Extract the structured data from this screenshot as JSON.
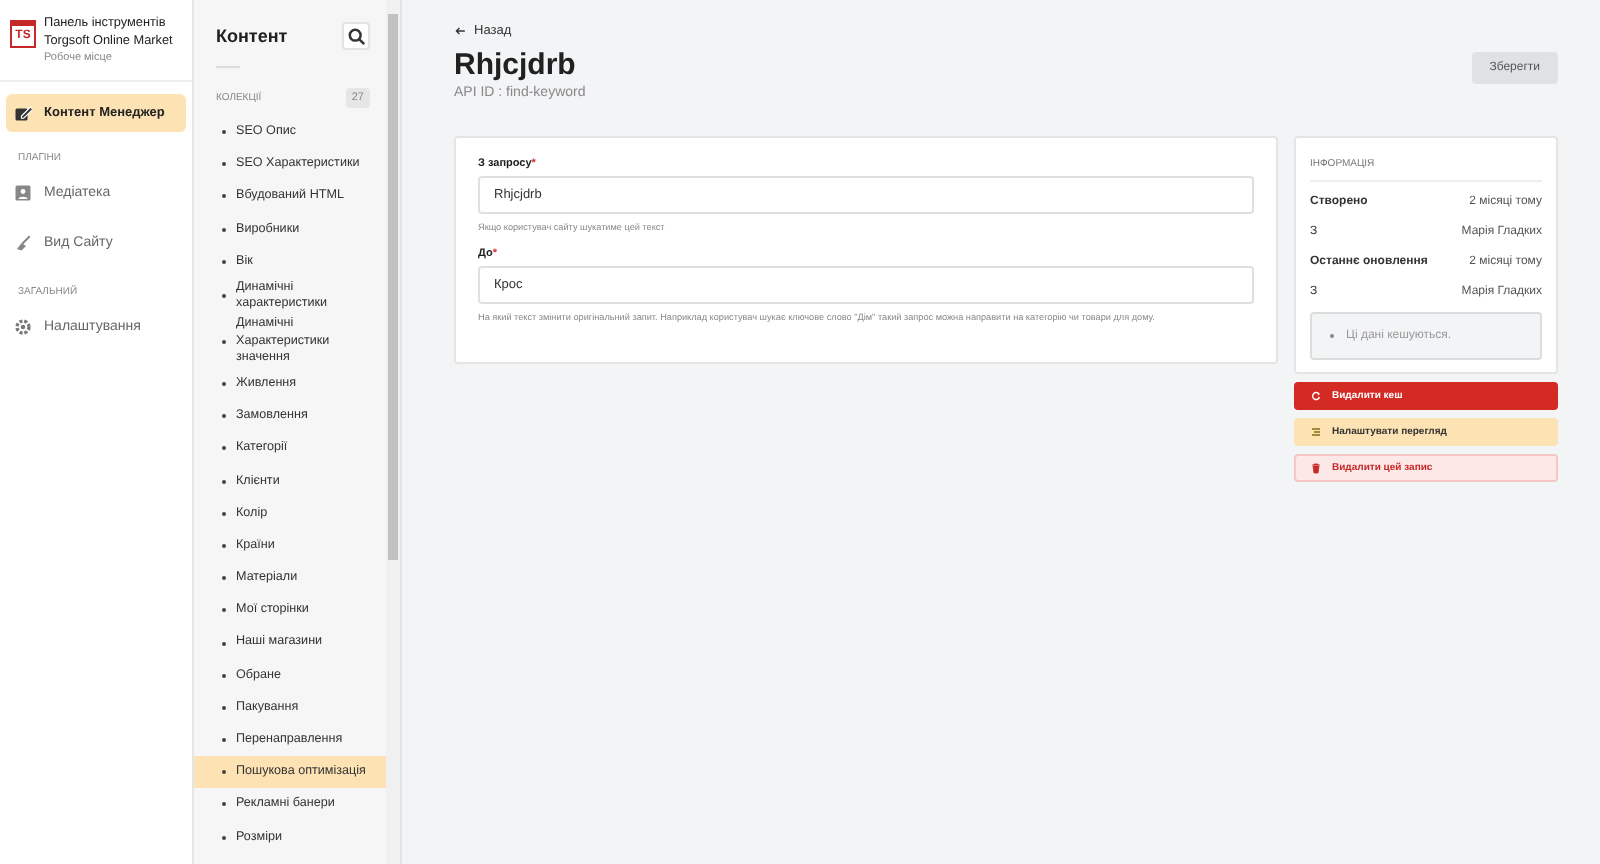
{
  "brand": {
    "logo": "TS",
    "title": "Панель інструментів Torgsoft Online Market",
    "subtitle": "Робоче місце"
  },
  "nav": [
    {
      "kind": "item",
      "label": "Контент Менеджер",
      "selected": true
    },
    {
      "kind": "heading",
      "label": "ПЛАГІНИ"
    },
    {
      "kind": "item",
      "label": "Медіатека",
      "selected": false
    },
    {
      "kind": "item",
      "label": "Вид Сайту",
      "selected": false
    },
    {
      "kind": "heading",
      "label": "ЗАГАЛЬНИЙ"
    },
    {
      "kind": "item",
      "label": "Налаштування",
      "selected": false
    }
  ],
  "content_sidebar": {
    "title": "Контент",
    "section": "КОЛЕКЦІЇ",
    "count": "27",
    "items": [
      {
        "label": "SEO Опис",
        "selected": false
      },
      {
        "label": "SEO Характеристики",
        "selected": false
      },
      {
        "label": "Вбудований HTML",
        "selected": false
      },
      {
        "label": "Виробники",
        "selected": false
      },
      {
        "label": "Вік",
        "selected": false
      },
      {
        "label": "Динамічні характеристики",
        "selected": false
      },
      {
        "label": "Динамічні Характеристики значення",
        "selected": false
      },
      {
        "label": "Живлення",
        "selected": false
      },
      {
        "label": "Замовлення",
        "selected": false
      },
      {
        "label": "Категорії",
        "selected": false
      },
      {
        "label": "Клієнти",
        "selected": false
      },
      {
        "label": "Колір",
        "selected": false
      },
      {
        "label": "Країни",
        "selected": false
      },
      {
        "label": "Матеріали",
        "selected": false
      },
      {
        "label": "Мої сторінки",
        "selected": false
      },
      {
        "label": "Наші магазини",
        "selected": false
      },
      {
        "label": "Обране",
        "selected": false
      },
      {
        "label": "Пакування",
        "selected": false
      },
      {
        "label": "Перенаправлення",
        "selected": false
      },
      {
        "label": "Пошукова оптимізація",
        "selected": true
      },
      {
        "label": "Рекламні банери",
        "selected": false
      },
      {
        "label": "Розміри",
        "selected": false
      }
    ]
  },
  "header": {
    "back": "Назад",
    "title": "Rhjcjdrb",
    "api_id": "API ID : find-keyword",
    "save": "Зберегти"
  },
  "form": {
    "fields": [
      {
        "label": "З запросу",
        "mark": "*",
        "value": "Rhjcjdrb",
        "hint": "Якщо користувач сайту шукатиме цей текст"
      },
      {
        "label": "До",
        "mark": "*",
        "value": "Крос",
        "hint": "На який текст змінити оригінальний запит. Наприклад користувач шукає ключове слово \"Дім\" такий запрос можна направити на категорію чи товари для дому."
      }
    ]
  },
  "info": {
    "title": "ІНФОРМАЦІЯ",
    "rows": [
      {
        "label": "Створено",
        "value": "2 місяці тому",
        "bold": true
      },
      {
        "label": "З",
        "value": "Марія Гладких",
        "bold": false
      },
      {
        "label": "Останнє оновлення",
        "value": "2 місяці тому",
        "bold": true
      },
      {
        "label": "З",
        "value": "Марія Гладких",
        "bold": false
      }
    ],
    "note": "Ці дані кешуються."
  },
  "actions": [
    {
      "kind": "danger",
      "label": "Видалити кеш"
    },
    {
      "kind": "warning",
      "label": "Налаштувати перегляд"
    },
    {
      "kind": "light",
      "label": "Видалити цей запис"
    }
  ]
}
